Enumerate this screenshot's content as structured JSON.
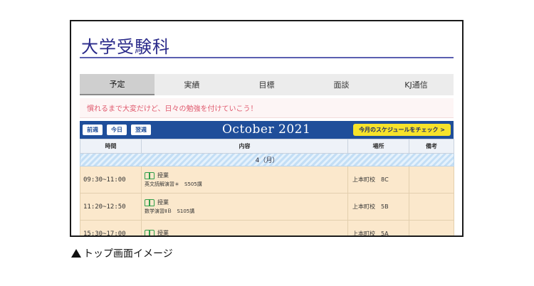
{
  "app": {
    "title": "大学受験科"
  },
  "tabs": [
    {
      "label": "予定",
      "active": true
    },
    {
      "label": "実績",
      "active": false
    },
    {
      "label": "目標",
      "active": false
    },
    {
      "label": "面談",
      "active": false
    },
    {
      "label": "KJ通信",
      "active": false
    }
  ],
  "notice": "慣れるまで大変だけど、日々の勉強を付けていこう！",
  "schedule": {
    "buttons": {
      "prev": "前週",
      "today": "今日",
      "next": "翌週"
    },
    "month": "October 2021",
    "check_button": "今月のスケジュールをチェック >",
    "columns": {
      "time": "時間",
      "content": "内容",
      "place": "場所",
      "note": "備考"
    },
    "day_label": "4（月）",
    "events": [
      {
        "time": "09:30~11:00",
        "type": "授業",
        "detail": "英文読解演習＊　S505講",
        "place": "上本町校　8C"
      },
      {
        "time": "11:20~12:50",
        "type": "授業",
        "detail": "数学演習ⅡＢ　S105講",
        "place": "上本町校　5B"
      },
      {
        "time": "15:30~17:00",
        "type": "授業",
        "detail": "",
        "place": "上本町校　5A"
      }
    ]
  },
  "caption": "トップ画面イメージ",
  "colors": {
    "header_blue": "#1f4e9a",
    "accent_yellow": "#f7e32a",
    "notice_pink": "#e05a6e",
    "event_bg": "#fbe8cc"
  }
}
